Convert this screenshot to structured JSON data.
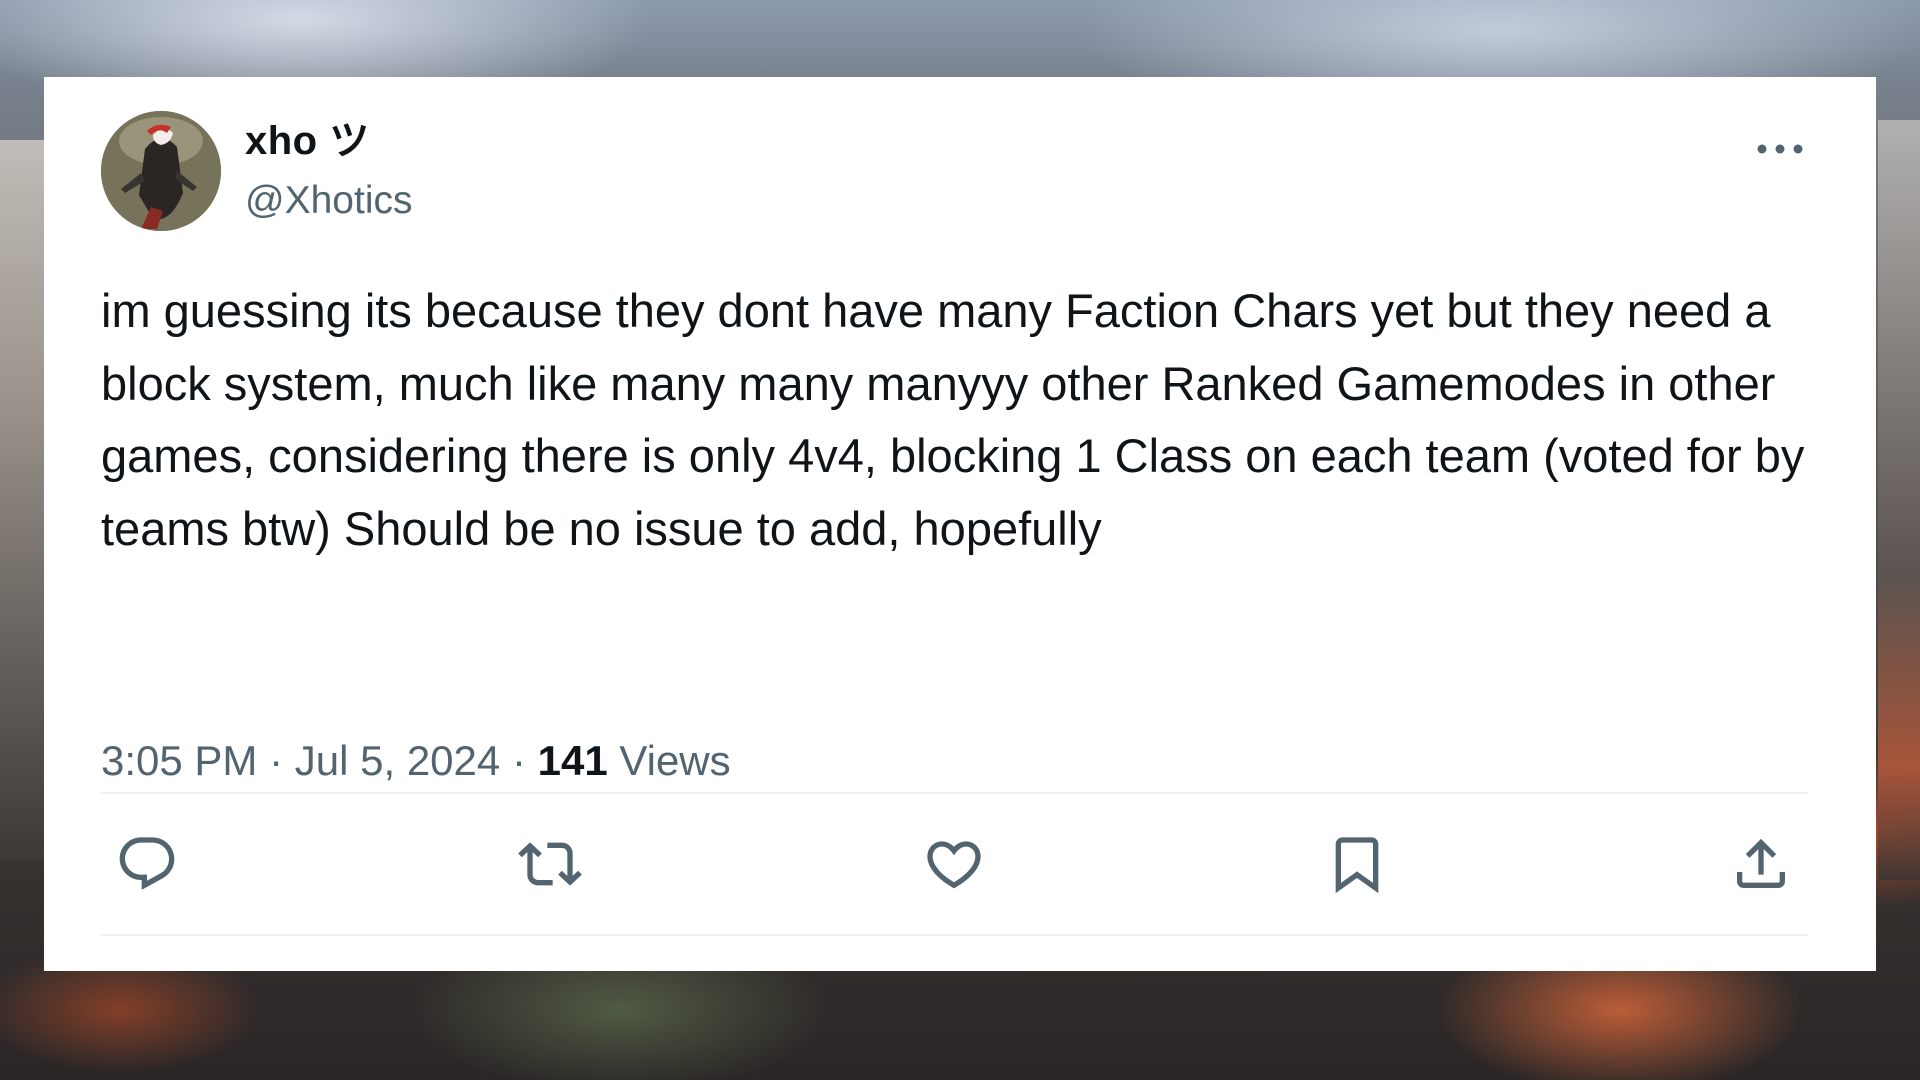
{
  "tweet": {
    "display_name": "xho ツ",
    "handle": "@Xhotics",
    "text": "im guessing its because they dont have many Faction Chars yet but they need a block system, much like many many manyyy other Ranked Gamemodes in other games, considering there is only 4v4, blocking 1 Class on each team (voted for by teams btw) Should be no issue to add, hopefully",
    "time": "3:05 PM",
    "separator": "·",
    "date": "Jul 5, 2024",
    "views_count": "141",
    "views_label": "Views"
  },
  "icons": {
    "more": "more-horizontal-icon",
    "reply": "reply-icon",
    "retweet": "retweet-icon",
    "like": "heart-icon",
    "bookmark": "bookmark-icon",
    "share": "share-icon"
  },
  "colors": {
    "text_primary": "#0f1419",
    "text_secondary": "#536471",
    "icon": "#536471",
    "divider": "#eff3f4",
    "card_background": "#ffffff"
  }
}
